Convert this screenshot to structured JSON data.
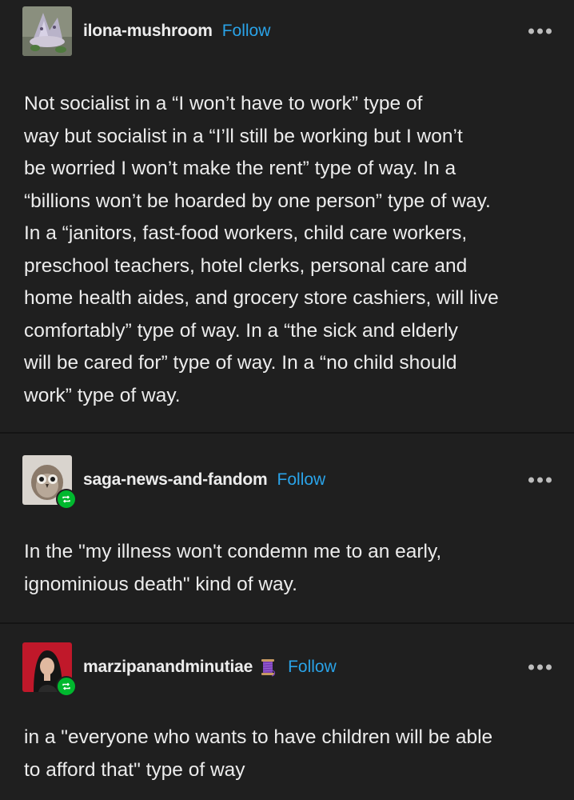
{
  "posts": [
    {
      "username": "ilona-mushroom",
      "follow_label": "Follow",
      "avatar_icon": "mushroom-avatar",
      "reblogged": false,
      "lines": [
        "Not socialist in a “I won’t have to work”  type of",
        "way but socialist in a “I’ll still be working but I won’t",
        "be worried I won’t make the rent” type of way. In a",
        "“billions won’t be hoarded by one person” type of way.",
        "In a “janitors, fast-food workers, child care workers,",
        "preschool teachers, hotel clerks, personal care and",
        "home health aides, and grocery store cashiers, will live",
        "comfortably” type of way. In a “the sick and elderly",
        "will be cared for” type of way. In a “no child should",
        "work” type of way."
      ]
    },
    {
      "username": "saga-news-and-fandom",
      "follow_label": "Follow",
      "avatar_icon": "owl-avatar",
      "reblogged": true,
      "lines": [
        "In the \"my illness won't condemn me to an early,",
        "ignominious death\" kind of way."
      ]
    },
    {
      "username": "marzipanandminutiae",
      "follow_label": "Follow",
      "avatar_icon": "portrait-avatar",
      "username_emoji": "thread-spool-icon",
      "reblogged": true,
      "lines": [
        "in a \"everyone who wants to have children will be able",
        "to afford that\" type of way"
      ]
    }
  ],
  "colors": {
    "background": "#1f1f1f",
    "follow": "#2aa3e8",
    "reblog_badge": "#00b82e",
    "text": "#ececec"
  }
}
